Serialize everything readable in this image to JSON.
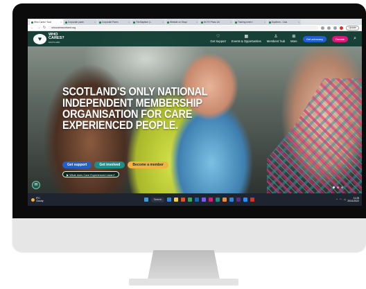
{
  "browser": {
    "tabs": [
      {
        "label": "Who Cares? Scot",
        "active": true
      },
      {
        "label": "Corporate paren",
        "active": false
      },
      {
        "label": "Corporate Paren",
        "active": false
      },
      {
        "label": "The Baptism | L",
        "active": false
      },
      {
        "label": "Website on Shopi",
        "active": false
      },
      {
        "label": "NCTS Photo Lib",
        "active": false
      },
      {
        "label": "Training event i",
        "active": false
      },
      {
        "label": "Equiform - Cola",
        "active": false
      }
    ],
    "url": "whocaresscotland.org",
    "update_label": "Update"
  },
  "site": {
    "logo": {
      "line1": "WHO",
      "line2": "CARES?",
      "line3": "SCOTLAND"
    },
    "nav": [
      {
        "label": "Get Support",
        "icon": "heart-icon",
        "glyph": "♡"
      },
      {
        "label": "Events & Opportunities",
        "icon": "calendar-icon",
        "glyph": "▦"
      },
      {
        "label": "Members' hub",
        "icon": "user-icon",
        "glyph": "♙"
      },
      {
        "label": "More",
        "icon": "grid-icon",
        "glyph": "⊞"
      }
    ],
    "advocacy_label": "Get advocacy",
    "donate_label": "Donate",
    "hero_title": "Scotland's only national independent membership organisation for care experienced people.",
    "cta": {
      "support": "Get support",
      "involved": "Get involved",
      "member": "Become a member",
      "meaning": "What does Care Experienced mean?"
    },
    "colors": {
      "nav_bg": "#0e3a30",
      "blue": "#1f5fd0",
      "pink": "#e0157d",
      "teal": "#1a8f8a",
      "gold": "#f3b23e"
    }
  },
  "taskbar": {
    "weather_temp": "9°C",
    "weather_desc": "Cloudy",
    "search_label": "Search",
    "time": "11:28",
    "date": "20/11/2022",
    "apps": [
      "#2b88d8",
      "#f7c948",
      "#e44d26",
      "#3aa757",
      "#0f6cbd",
      "#7a5af8",
      "#e0157d",
      "#1a8f8a",
      "#f28b30",
      "#2b88d8",
      "#5c2d91",
      "#1e90ff",
      "#d93025"
    ]
  }
}
